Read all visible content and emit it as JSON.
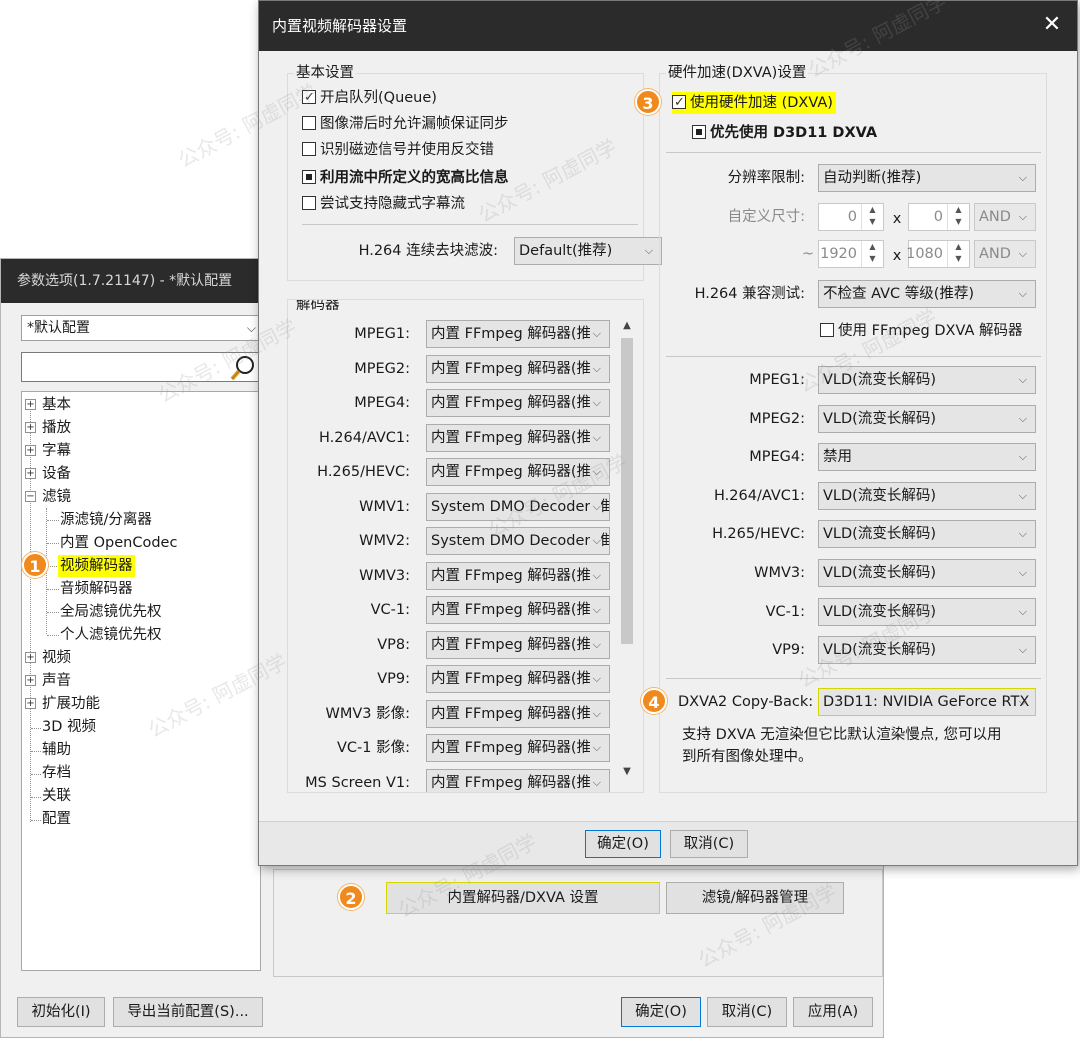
{
  "bg_dialog": {
    "title": "参数选项(1.7.21147) - *默认配置",
    "profile": "*默认配置",
    "tree": {
      "basic": "基本",
      "play": "播放",
      "subtitle": "字幕",
      "device": "设备",
      "filter": "滤镜",
      "source_filter": "源滤镜/分离器",
      "opencodec": "内置 OpenCodec",
      "video_decoder": "视频解码器",
      "audio_decoder": "音频解码器",
      "global_priority": "全局滤镜优先权",
      "personal_priority": "个人滤镜优先权",
      "video": "视频",
      "audio": "声音",
      "extension": "扩展功能",
      "video3d": "3D 视频",
      "assist": "辅助",
      "archive": "存档",
      "assoc": "关联",
      "config": "配置"
    },
    "btn_dxva": "内置解码器/DXVA 设置",
    "btn_filter_mgr": "滤镜/解码器管理",
    "btn_init": "初始化(I)",
    "btn_export": "导出当前配置(S)...",
    "btn_ok": "确定(O)",
    "btn_cancel": "取消(C)",
    "btn_apply": "应用(A)"
  },
  "dialog": {
    "title": "内置视频解码器设置",
    "close": "✕",
    "basic_group": "基本设置",
    "cb_queue": "开启队列(Queue)",
    "cb_dropframe": "图像滞后时允许漏帧保证同步",
    "cb_deinterlace": "识别磁迹信号并使用反交错",
    "cb_aspect": "利用流中所定义的宽高比信息",
    "cb_hidden_sub": "尝试支持隐藏式字幕流",
    "h264_deblock_label": "H.264 连续去块滤波:",
    "h264_deblock_value": "Default(推荐)",
    "decoder_group": "解码器",
    "decoders": [
      {
        "label": "MPEG1:",
        "value": "内置 FFmpeg 解码器(推"
      },
      {
        "label": "MPEG2:",
        "value": "内置 FFmpeg 解码器(推"
      },
      {
        "label": "MPEG4:",
        "value": "内置 FFmpeg 解码器(推"
      },
      {
        "label": "H.264/AVC1:",
        "value": "内置 FFmpeg 解码器(推"
      },
      {
        "label": "H.265/HEVC:",
        "value": "内置 FFmpeg 解码器(推"
      },
      {
        "label": "WMV1:",
        "value": "System DMO Decoder(推"
      },
      {
        "label": "WMV2:",
        "value": "System DMO Decoder(推"
      },
      {
        "label": "WMV3:",
        "value": "内置 FFmpeg 解码器(推"
      },
      {
        "label": "VC-1:",
        "value": "内置 FFmpeg 解码器(推"
      },
      {
        "label": "VP8:",
        "value": "内置 FFmpeg 解码器(推"
      },
      {
        "label": "VP9:",
        "value": "内置 FFmpeg 解码器(推"
      },
      {
        "label": "WMV3 影像:",
        "value": "内置 FFmpeg 解码器(推"
      },
      {
        "label": "VC-1 影像:",
        "value": "内置 FFmpeg 解码器(推"
      },
      {
        "label": "MS Screen V1:",
        "value": "内置 FFmpeg 解码器(推"
      }
    ],
    "hw_group": "硬件加速(DXVA)设置",
    "cb_hw": "使用硬件加速 (DXVA)",
    "cb_d3d11": "优先使用 D3D11 DXVA",
    "res_limit_label": "分辨率限制:",
    "res_limit_value": "自动判断(推荐)",
    "custom_size_label": "自定义尺寸:",
    "min_w": "0",
    "min_h": "0",
    "max_w": "1920",
    "max_h": "1080",
    "times": "x",
    "tilde": "~",
    "and": "AND",
    "h264_compat_label": "H.264 兼容测试:",
    "h264_compat_value": "不检查 AVC 等级(推荐)",
    "cb_ffmpeg_dxva": "使用 FFmpeg DXVA 解码器",
    "hw_decoders": [
      {
        "label": "MPEG1:",
        "value": "VLD(流变长解码)"
      },
      {
        "label": "MPEG2:",
        "value": "VLD(流变长解码)"
      },
      {
        "label": "MPEG4:",
        "value": "禁用"
      },
      {
        "label": "H.264/AVC1:",
        "value": "VLD(流变长解码)"
      },
      {
        "label": "H.265/HEVC:",
        "value": "VLD(流变长解码)"
      },
      {
        "label": "WMV3:",
        "value": "VLD(流变长解码)"
      },
      {
        "label": "VC-1:",
        "value": "VLD(流变长解码)"
      },
      {
        "label": "VP9:",
        "value": "VLD(流变长解码)"
      }
    ],
    "copyback_label": "DXVA2 Copy-Back:",
    "copyback_value": "D3D11: NVIDIA GeForce RTX",
    "note_line1": "支持 DXVA 无渲染但它比默认渲染慢点, 您可以用",
    "note_line2": "到所有图像处理中。",
    "btn_ok": "确定(O)",
    "btn_cancel": "取消(C)"
  },
  "badges": [
    "1",
    "2",
    "3",
    "4"
  ],
  "watermark": "公众号: 阿虚同学",
  "colors": {
    "highlight": "#ffff00",
    "badge": "#f08a1c",
    "titlebar": "#2b2b2b"
  }
}
